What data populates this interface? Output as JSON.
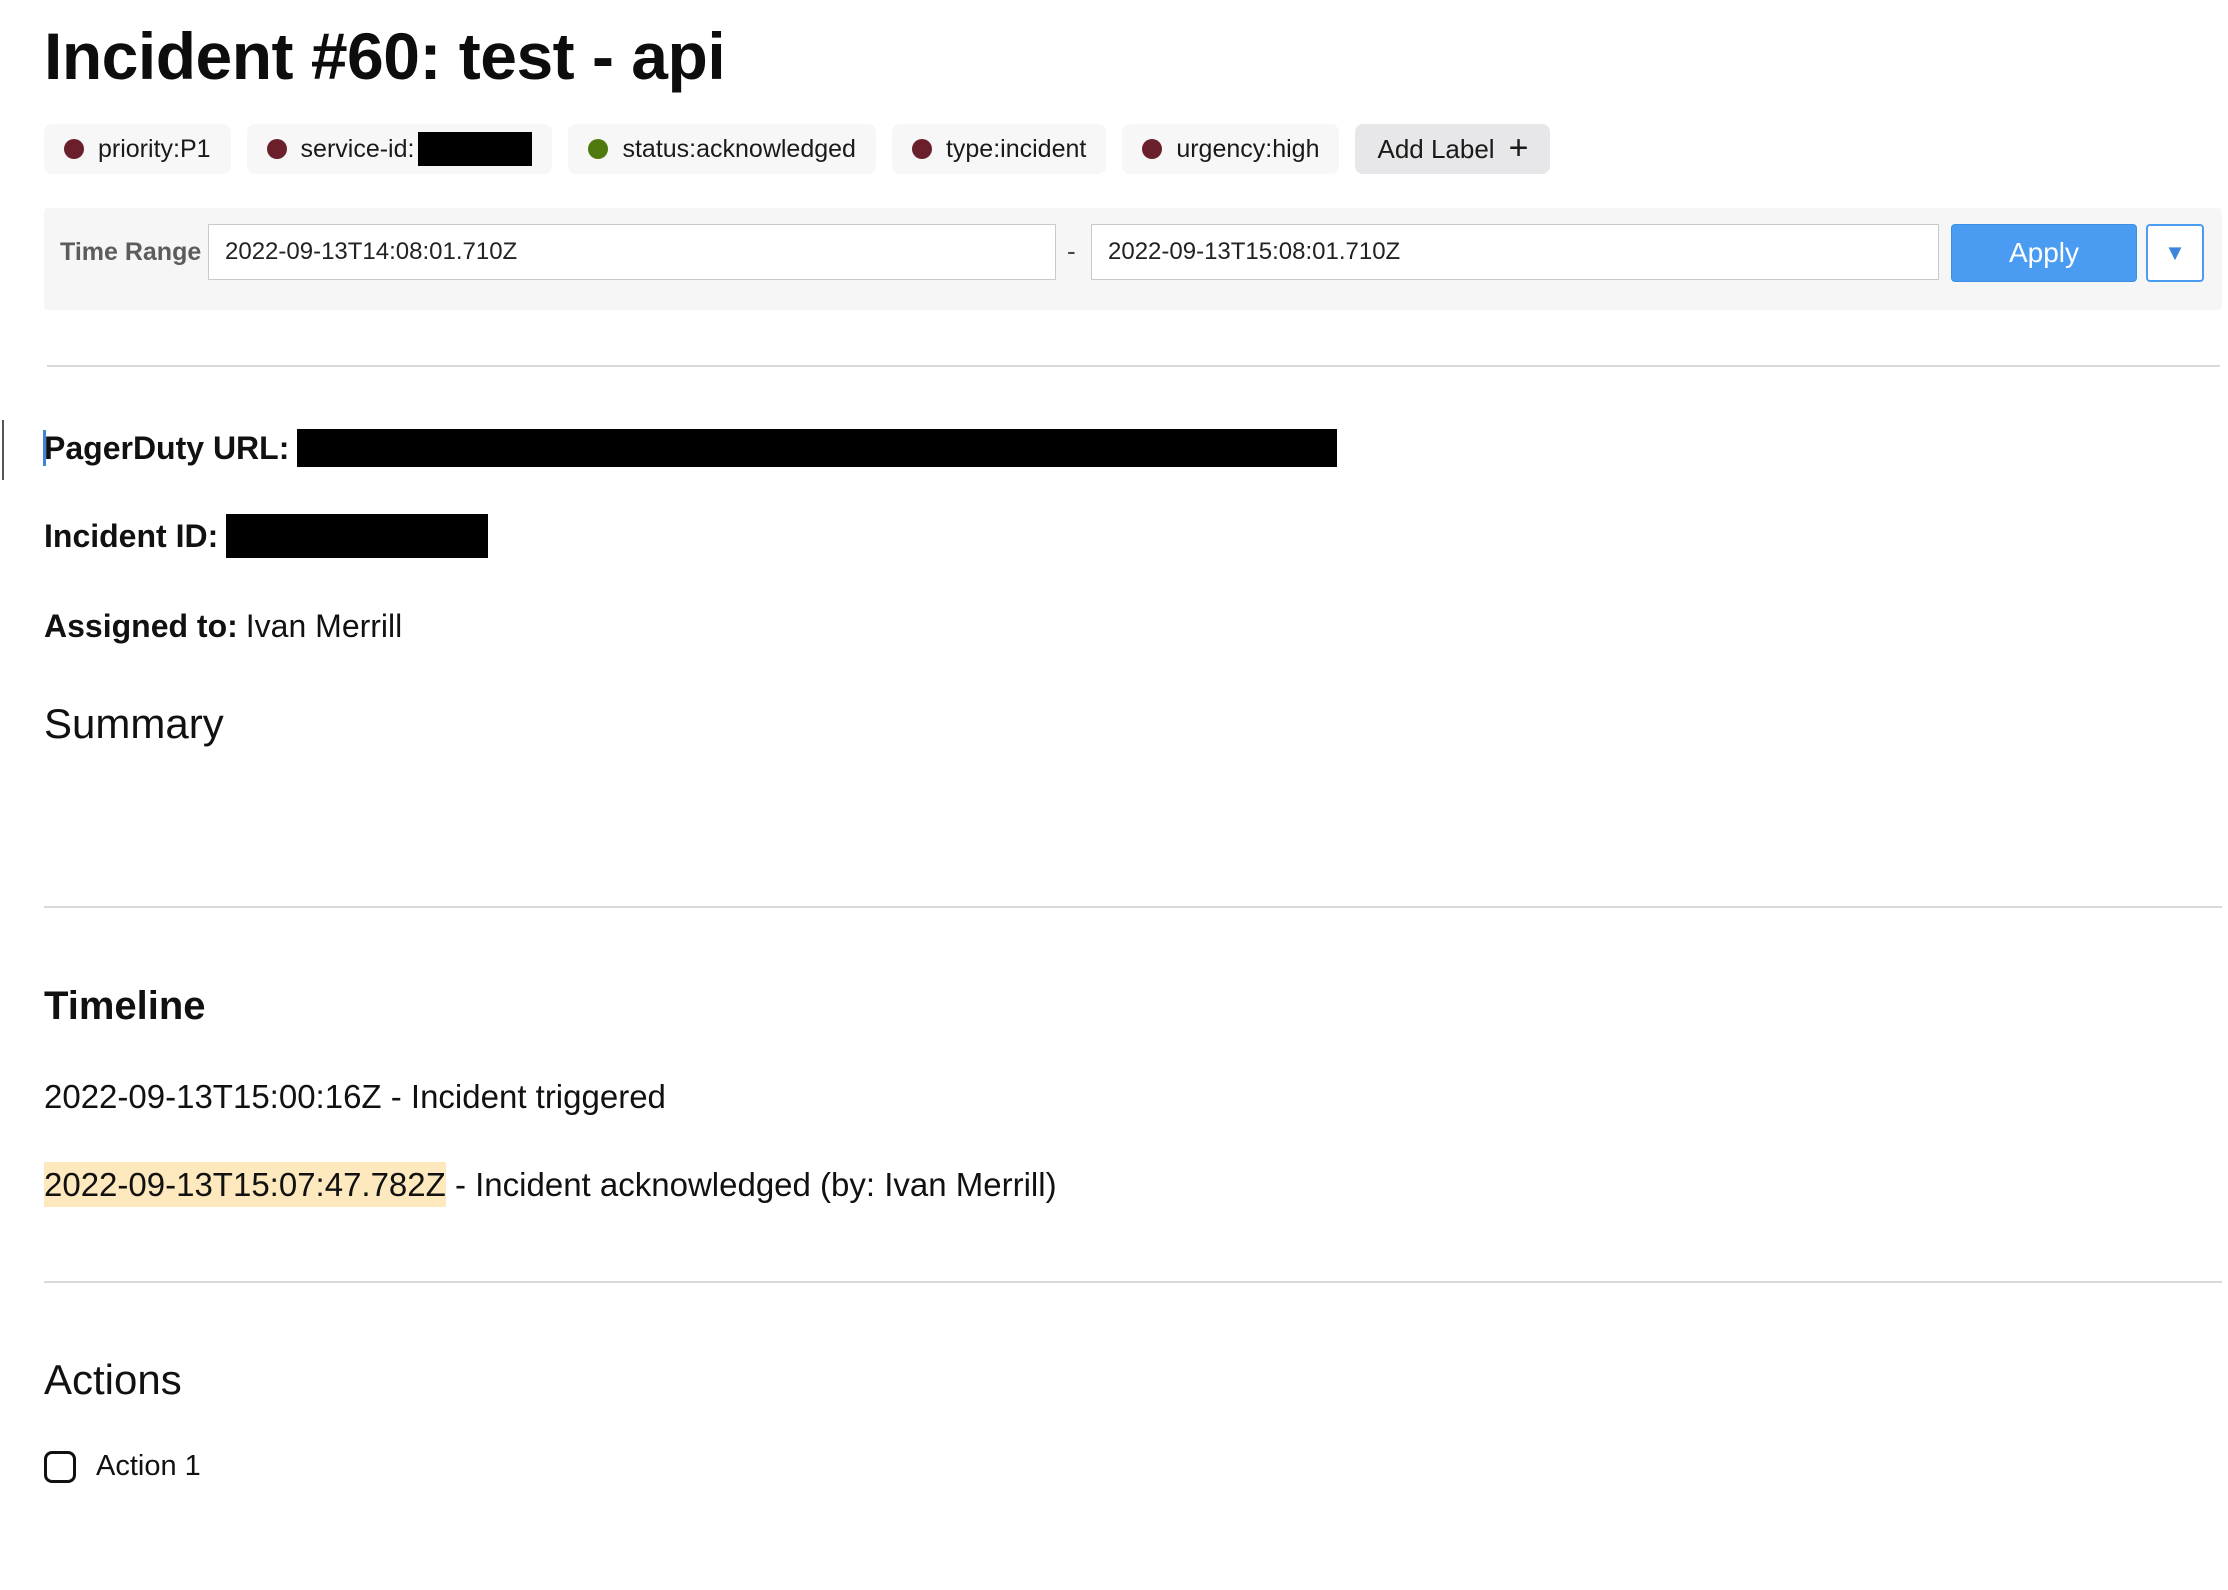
{
  "incident": {
    "title": "Incident #60: test - api"
  },
  "labels": [
    {
      "text": "priority:P1",
      "color": "#6b1f2a"
    },
    {
      "text": "service-id:",
      "color": "#6b1f2a"
    },
    {
      "text": "status:acknowledged",
      "color": "#4e7a0f"
    },
    {
      "text": "type:incident",
      "color": "#6b1f2a"
    },
    {
      "text": "urgency:high",
      "color": "#6b1f2a"
    }
  ],
  "add_label": {
    "text": "Add Label",
    "icon": "plus-icon"
  },
  "time_range": {
    "label": "Time Range",
    "start": "2022-09-13T14:08:01.710Z",
    "separator": "-",
    "end": "2022-09-13T15:08:01.710Z",
    "apply_label": "Apply",
    "dropdown_icon": "triangle-down-icon"
  },
  "fields": {
    "pagerduty_url_label": "PagerDuty URL:",
    "incident_id_label": "Incident ID:",
    "assigned_to_label": "Assigned to:",
    "assigned_to_value": "Ivan Merrill"
  },
  "sections": {
    "summary": "Summary",
    "timeline": "Timeline",
    "actions": "Actions"
  },
  "timeline": [
    {
      "time": "2022-09-13T15:00:16Z",
      "text": " - Incident triggered"
    },
    {
      "time": "2022-09-13T15:07:47.782Z",
      "text": " - Incident acknowledged (by: Ivan Merrill)"
    }
  ],
  "actions": [
    {
      "label": "Action 1",
      "checked": false
    }
  ],
  "colors": {
    "accent": "#4a9cf2",
    "highlight": "#fde9bd"
  }
}
